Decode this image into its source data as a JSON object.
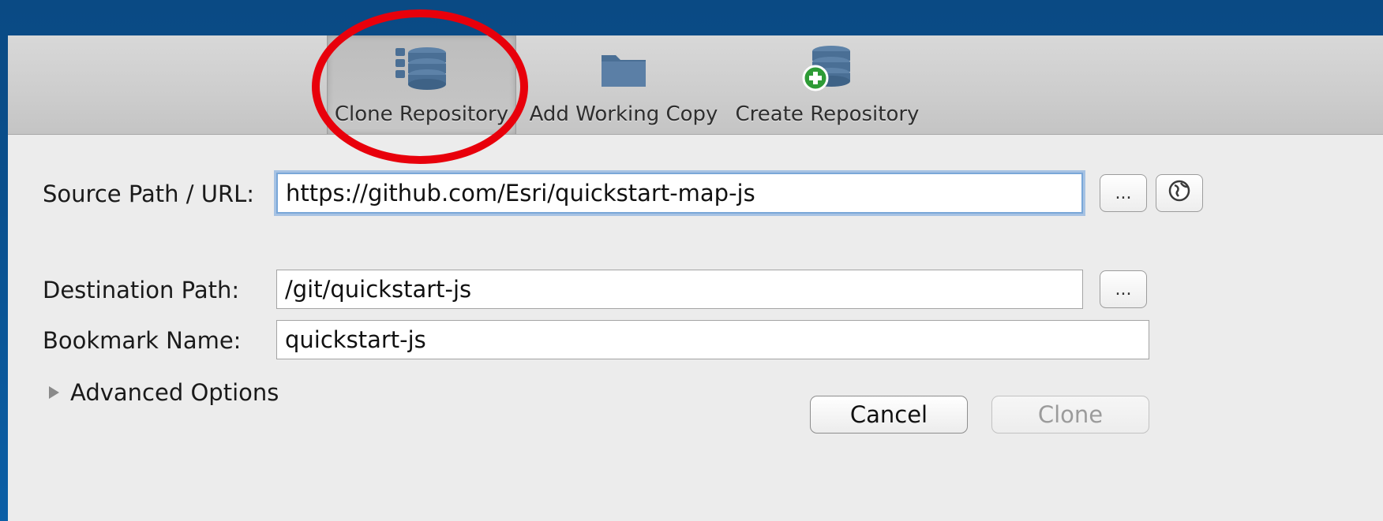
{
  "toolbar": {
    "items": [
      {
        "label": "Clone Repository",
        "icon": "database-stack-icon",
        "selected": true
      },
      {
        "label": "Add Working Copy",
        "icon": "folder-icon",
        "selected": false
      },
      {
        "label": "Create Repository",
        "icon": "database-add-icon",
        "selected": false
      }
    ]
  },
  "form": {
    "source_label": "Source Path / URL:",
    "source_value": "https://github.com/Esri/quickstart-map-js",
    "destination_label": "Destination Path:",
    "destination_value": "/git/quickstart-js",
    "bookmark_label": "Bookmark Name:",
    "bookmark_value": "quickstart-js",
    "browse_label": "...",
    "advanced_label": "Advanced Options"
  },
  "buttons": {
    "cancel": "Cancel",
    "clone": "Clone"
  },
  "colors": {
    "highlight_ring": "#e8000b",
    "background_blue": "#0a4f8c",
    "icon_blue": "#4a6f95",
    "add_green": "#2e9b36"
  }
}
